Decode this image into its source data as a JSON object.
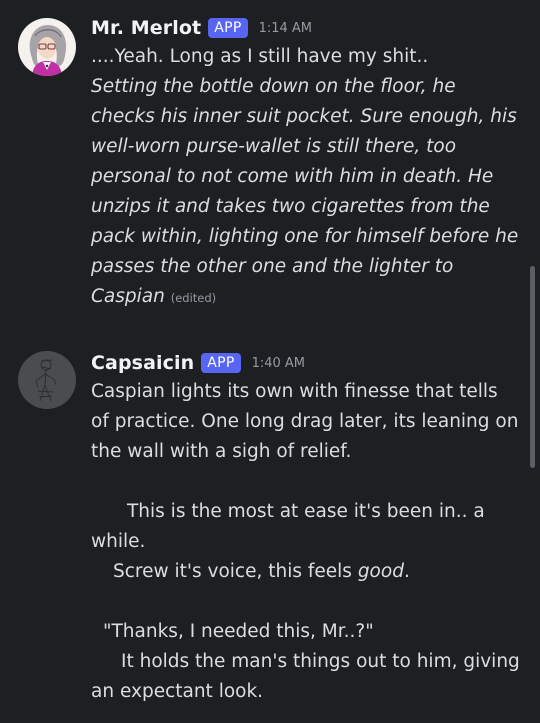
{
  "messages": [
    {
      "author": "Mr. Merlot",
      "badge": "APP",
      "time": "1:14 AM",
      "line1": "....Yeah. Long as I still have my shit..",
      "italic_text": "Setting the bottle down on the floor, he checks his inner suit pocket. Sure enough, his well-worn purse-wallet is still there, too personal to not come with him in death. He unzips it and takes two cigarettes from the pack within, lighting one for himself before he passes the other one and the lighter to Caspian",
      "edited": "(edited)"
    },
    {
      "author": "Capsaicin",
      "badge": "APP",
      "time": "1:40 AM",
      "para1": "Caspian lights its own with finesse that tells of practice. One long drag later, its leaning on the wall with a sigh of relief.",
      "para2": "This is the most at ease it's been in.. a while.",
      "para3_prefix": "Screw it's voice, this feels ",
      "para3_italic": "good",
      "para3_suffix": ".",
      "para4": "\"Thanks, I needed this, Mr..?\"",
      "para5": "It holds the man's things out to him, giving an expectant look."
    }
  ],
  "colors": {
    "background": "#1e1f22",
    "app_badge": "#5865f2",
    "username": "#f2f3f5",
    "timestamp": "#949ba4",
    "text": "#dbdee1"
  }
}
